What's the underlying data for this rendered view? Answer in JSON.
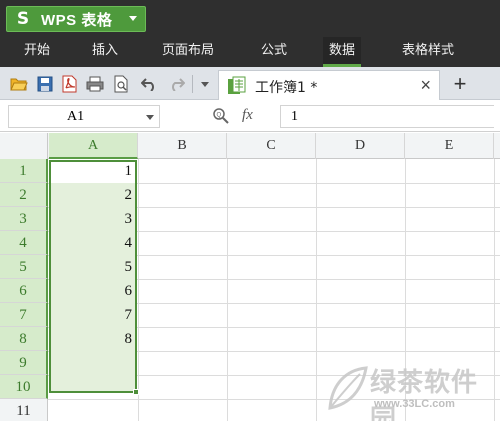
{
  "app": {
    "logo_glyph": "S",
    "name": "WPS 表格"
  },
  "menu": {
    "tabs": [
      "开始",
      "插入",
      "页面布局",
      "公式",
      "数据",
      "表格样式"
    ],
    "active_index": 4
  },
  "toolbar": {
    "icons": [
      "open-folder-icon",
      "save-icon",
      "export-pdf-icon",
      "print-icon",
      "print-preview-icon",
      "undo-icon",
      "redo-icon",
      "more-dropdown-icon"
    ],
    "document_tab": {
      "name": "工作簿1 *",
      "close_glyph": "×"
    },
    "new_tab_glyph": "+"
  },
  "formula_bar": {
    "name_box": "A1",
    "fx_label": "fx",
    "content": "1"
  },
  "sheet": {
    "columns": [
      "A",
      "B",
      "C",
      "D",
      "E"
    ],
    "selected_column": "A",
    "rows": [
      "1",
      "2",
      "3",
      "4",
      "5",
      "6",
      "7",
      "8",
      "9",
      "10",
      "11"
    ],
    "selected_rows": [
      "1",
      "2",
      "3",
      "4",
      "5",
      "6",
      "7",
      "8",
      "9",
      "10"
    ],
    "column_a_values": [
      "1",
      "2",
      "3",
      "4",
      "5",
      "6",
      "7",
      "8",
      "",
      "",
      ""
    ],
    "selection": "A1:A10",
    "active_cell": "A1"
  },
  "watermark": {
    "title": "绿茶软件园",
    "url": "www.33LC.com"
  },
  "colors": {
    "title_bar": "#2f2f2f",
    "brand_green": "#4e9a3c",
    "selection_fill": "#e4f0dc",
    "selection_border": "#4e8f3a",
    "header_selected": "#d6ebcb"
  }
}
